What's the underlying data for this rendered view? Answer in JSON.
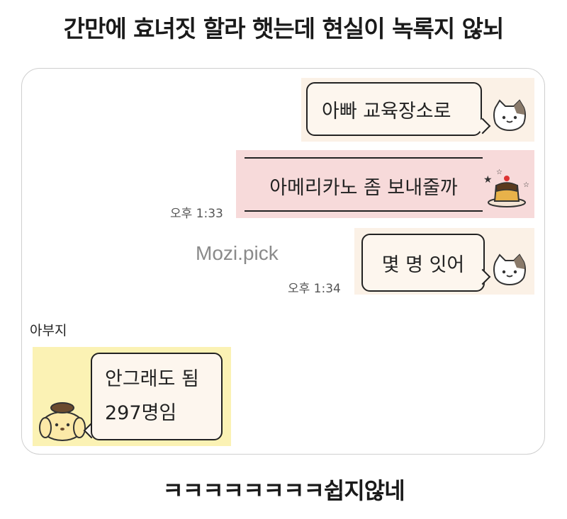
{
  "page": {
    "title": "간만에 효녀짓 할라 햇는데 현실이 녹록지 않뇌",
    "caption": "ㅋㅋㅋㅋㅋㅋㅋㅋ쉽지않네",
    "watermark": "Mozi.pick"
  },
  "chat": {
    "sender_name": "아부지",
    "messages": [
      {
        "side": "outgoing",
        "text": "아빠 교육장소로",
        "sticker": "cat-face-icon",
        "time": ""
      },
      {
        "side": "outgoing",
        "text": "아메리카노 좀 보내줄까",
        "sticker": "pudding-icon",
        "time": "오후 1:33",
        "background": "#f7dada"
      },
      {
        "side": "outgoing",
        "text": "몇 명 잇어",
        "sticker": "cat-face-icon",
        "time": "오후 1:34"
      },
      {
        "side": "incoming",
        "lines": [
          "안그래도 됨",
          "297명임"
        ],
        "sticker": "pompompurin-icon",
        "background": "#fbf2b4"
      }
    ]
  },
  "colors": {
    "outgoing_bg": "#fbf1e6",
    "pink_bg": "#f7dada",
    "incoming_bg": "#fbf2b4",
    "bubble_border": "#222222"
  }
}
